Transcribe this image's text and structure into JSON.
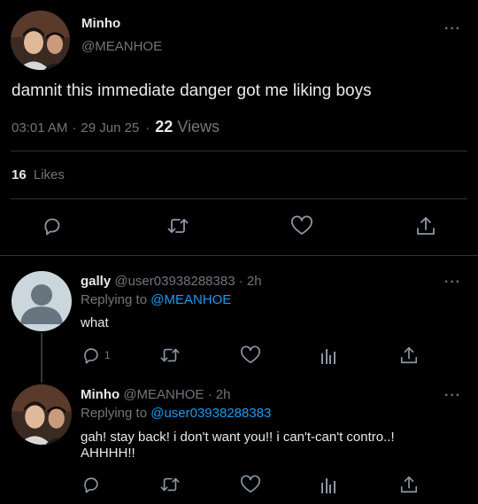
{
  "main_tweet": {
    "display_name": "Minho",
    "handle": "@MEANHOE",
    "text": "damnit this immediate danger got me liking boys",
    "time": "03:01 AM",
    "date": "29 Jun 25",
    "separator": "·",
    "views_count": "22",
    "views_label": "Views",
    "likes_count": "16",
    "likes_label": "Likes"
  },
  "reply1": {
    "display_name": "gally",
    "handle": "@user03938288383",
    "age": "· 2h",
    "replying_label": "Replying to",
    "replying_to": "@MEANHOE",
    "text": "what",
    "reply_count": "1"
  },
  "reply2": {
    "display_name": "Minho",
    "handle": "@MEANHOE",
    "age": "· 2h",
    "replying_label": "Replying to",
    "replying_to": "@user03938288383",
    "text_line1": "gah! stay back! i don't want you!! i can't-can't contro..!",
    "text_line2": "AHHHH!!"
  },
  "more_icon": "···",
  "colors": {
    "background": "#000000",
    "text": "#e7e9ea",
    "muted": "#71767b",
    "link": "#1d9bf0",
    "divider": "#2f3336"
  },
  "icons": [
    "reply-icon",
    "retweet-icon",
    "like-icon",
    "share-icon",
    "analytics-icon",
    "more-icon"
  ]
}
